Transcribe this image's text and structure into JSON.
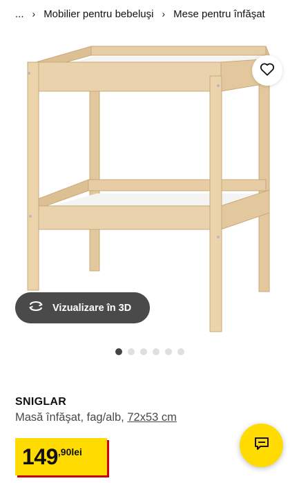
{
  "breadcrumb": {
    "items": [
      "...",
      "Mobilier pentru bebeluşi",
      "Mese pentru înfăşat"
    ],
    "separator": "›"
  },
  "product_image": {
    "alt": "",
    "colors": {
      "wood": "#e8cfa6",
      "wood_dark": "#c9a87a",
      "shelf": "#f4f4f2"
    }
  },
  "favourite": {
    "icon": "heart-icon"
  },
  "view3d": {
    "label": "Vizualizare în 3D",
    "icon": "rotate-3d-icon"
  },
  "carousel": {
    "total": 6,
    "active": 1
  },
  "product": {
    "name": "SNIGLAR",
    "description": "Masă înfăşat, fag/alb, ",
    "dimensions": "72x53 cm"
  },
  "price": {
    "integer": "149",
    "decimal": ",90",
    "currency": "lei",
    "colors": {
      "background": "#ffdb00",
      "shadow": "#cc0008"
    }
  },
  "chat": {
    "icon": "chat-icon",
    "color": "#ffdb00"
  }
}
